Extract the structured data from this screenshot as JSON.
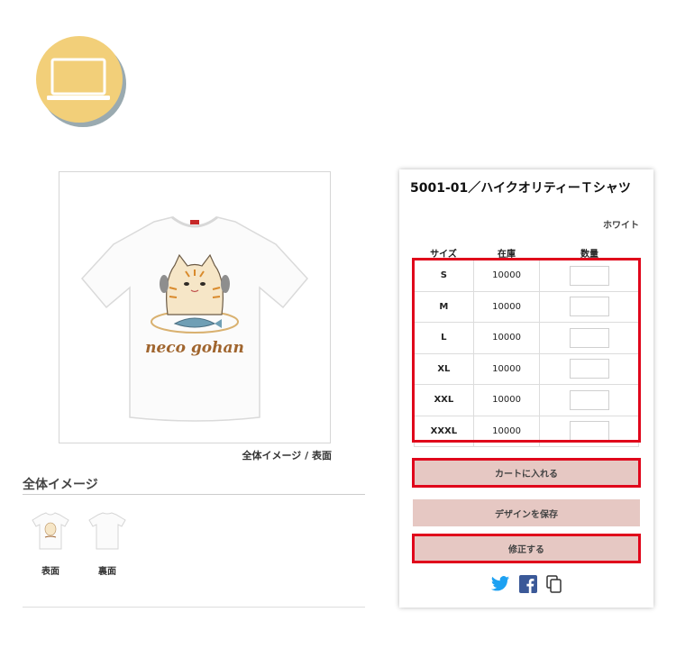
{
  "preview": {
    "caption": "全体イメージ / 表面",
    "print_text": "neco gohan"
  },
  "thumbnails": {
    "title": "全体イメージ",
    "items": [
      {
        "label": "表面"
      },
      {
        "label": "裏面"
      }
    ]
  },
  "product": {
    "title": "5001-01／ハイクオリティーＴシャツ",
    "color": "ホワイト",
    "columns": {
      "size": "サイズ",
      "stock": "在庫",
      "qty": "数量"
    },
    "rows": [
      {
        "size": "S",
        "stock": "10000",
        "qty": ""
      },
      {
        "size": "M",
        "stock": "10000",
        "qty": ""
      },
      {
        "size": "L",
        "stock": "10000",
        "qty": ""
      },
      {
        "size": "XL",
        "stock": "10000",
        "qty": ""
      },
      {
        "size": "XXL",
        "stock": "10000",
        "qty": ""
      },
      {
        "size": "XXXL",
        "stock": "10000",
        "qty": ""
      }
    ]
  },
  "actions": {
    "add_to_cart": "カートに入れる",
    "save_design": "デザインを保存",
    "modify": "修正する"
  },
  "share": [
    "twitter-icon",
    "facebook-icon",
    "copy-icon"
  ],
  "colors": {
    "badge": "#f2cf79",
    "button": "#e6c8c3",
    "highlight": "#e0061b",
    "twitter": "#1da1f2",
    "facebook": "#3b5998"
  }
}
